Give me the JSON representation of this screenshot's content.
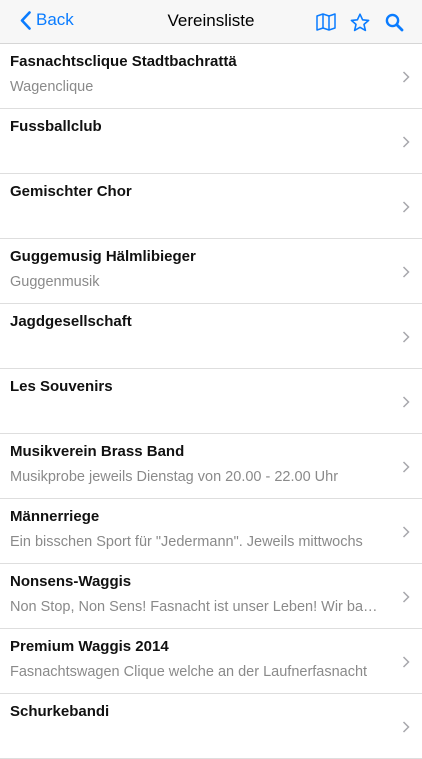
{
  "nav": {
    "back_label": "Back",
    "title": "Vereinsliste",
    "accent_color": "#0a7cff",
    "icons": [
      "map-icon",
      "star-icon",
      "search-icon"
    ]
  },
  "items": [
    {
      "title": "Fasnachtsclique Stadtbachrattä",
      "subtitle": "Wagenclique"
    },
    {
      "title": "Fussballclub",
      "subtitle": ""
    },
    {
      "title": "Gemischter Chor",
      "subtitle": ""
    },
    {
      "title": "Guggemusig Hälmlibieger",
      "subtitle": "Guggenmusik"
    },
    {
      "title": "Jagdgesellschaft",
      "subtitle": ""
    },
    {
      "title": "Les Souvenirs",
      "subtitle": ""
    },
    {
      "title": "Musikverein Brass Band",
      "subtitle": "Musikprobe jeweils Dienstag von 20.00 - 22.00 Uhr"
    },
    {
      "title": "Männerriege",
      "subtitle": "Ein bisschen Sport für \"Jedermann\". Jeweils mittwochs"
    },
    {
      "title": "Nonsens-Waggis",
      "subtitle": "Non Stop, Non Sens!  Fasnacht ist unser Leben! Wir bauen"
    },
    {
      "title": "Premium Waggis 2014",
      "subtitle": "Fasnachtswagen Clique welche an der Laufnerfasnacht"
    },
    {
      "title": "Schurkebandi",
      "subtitle": ""
    }
  ]
}
